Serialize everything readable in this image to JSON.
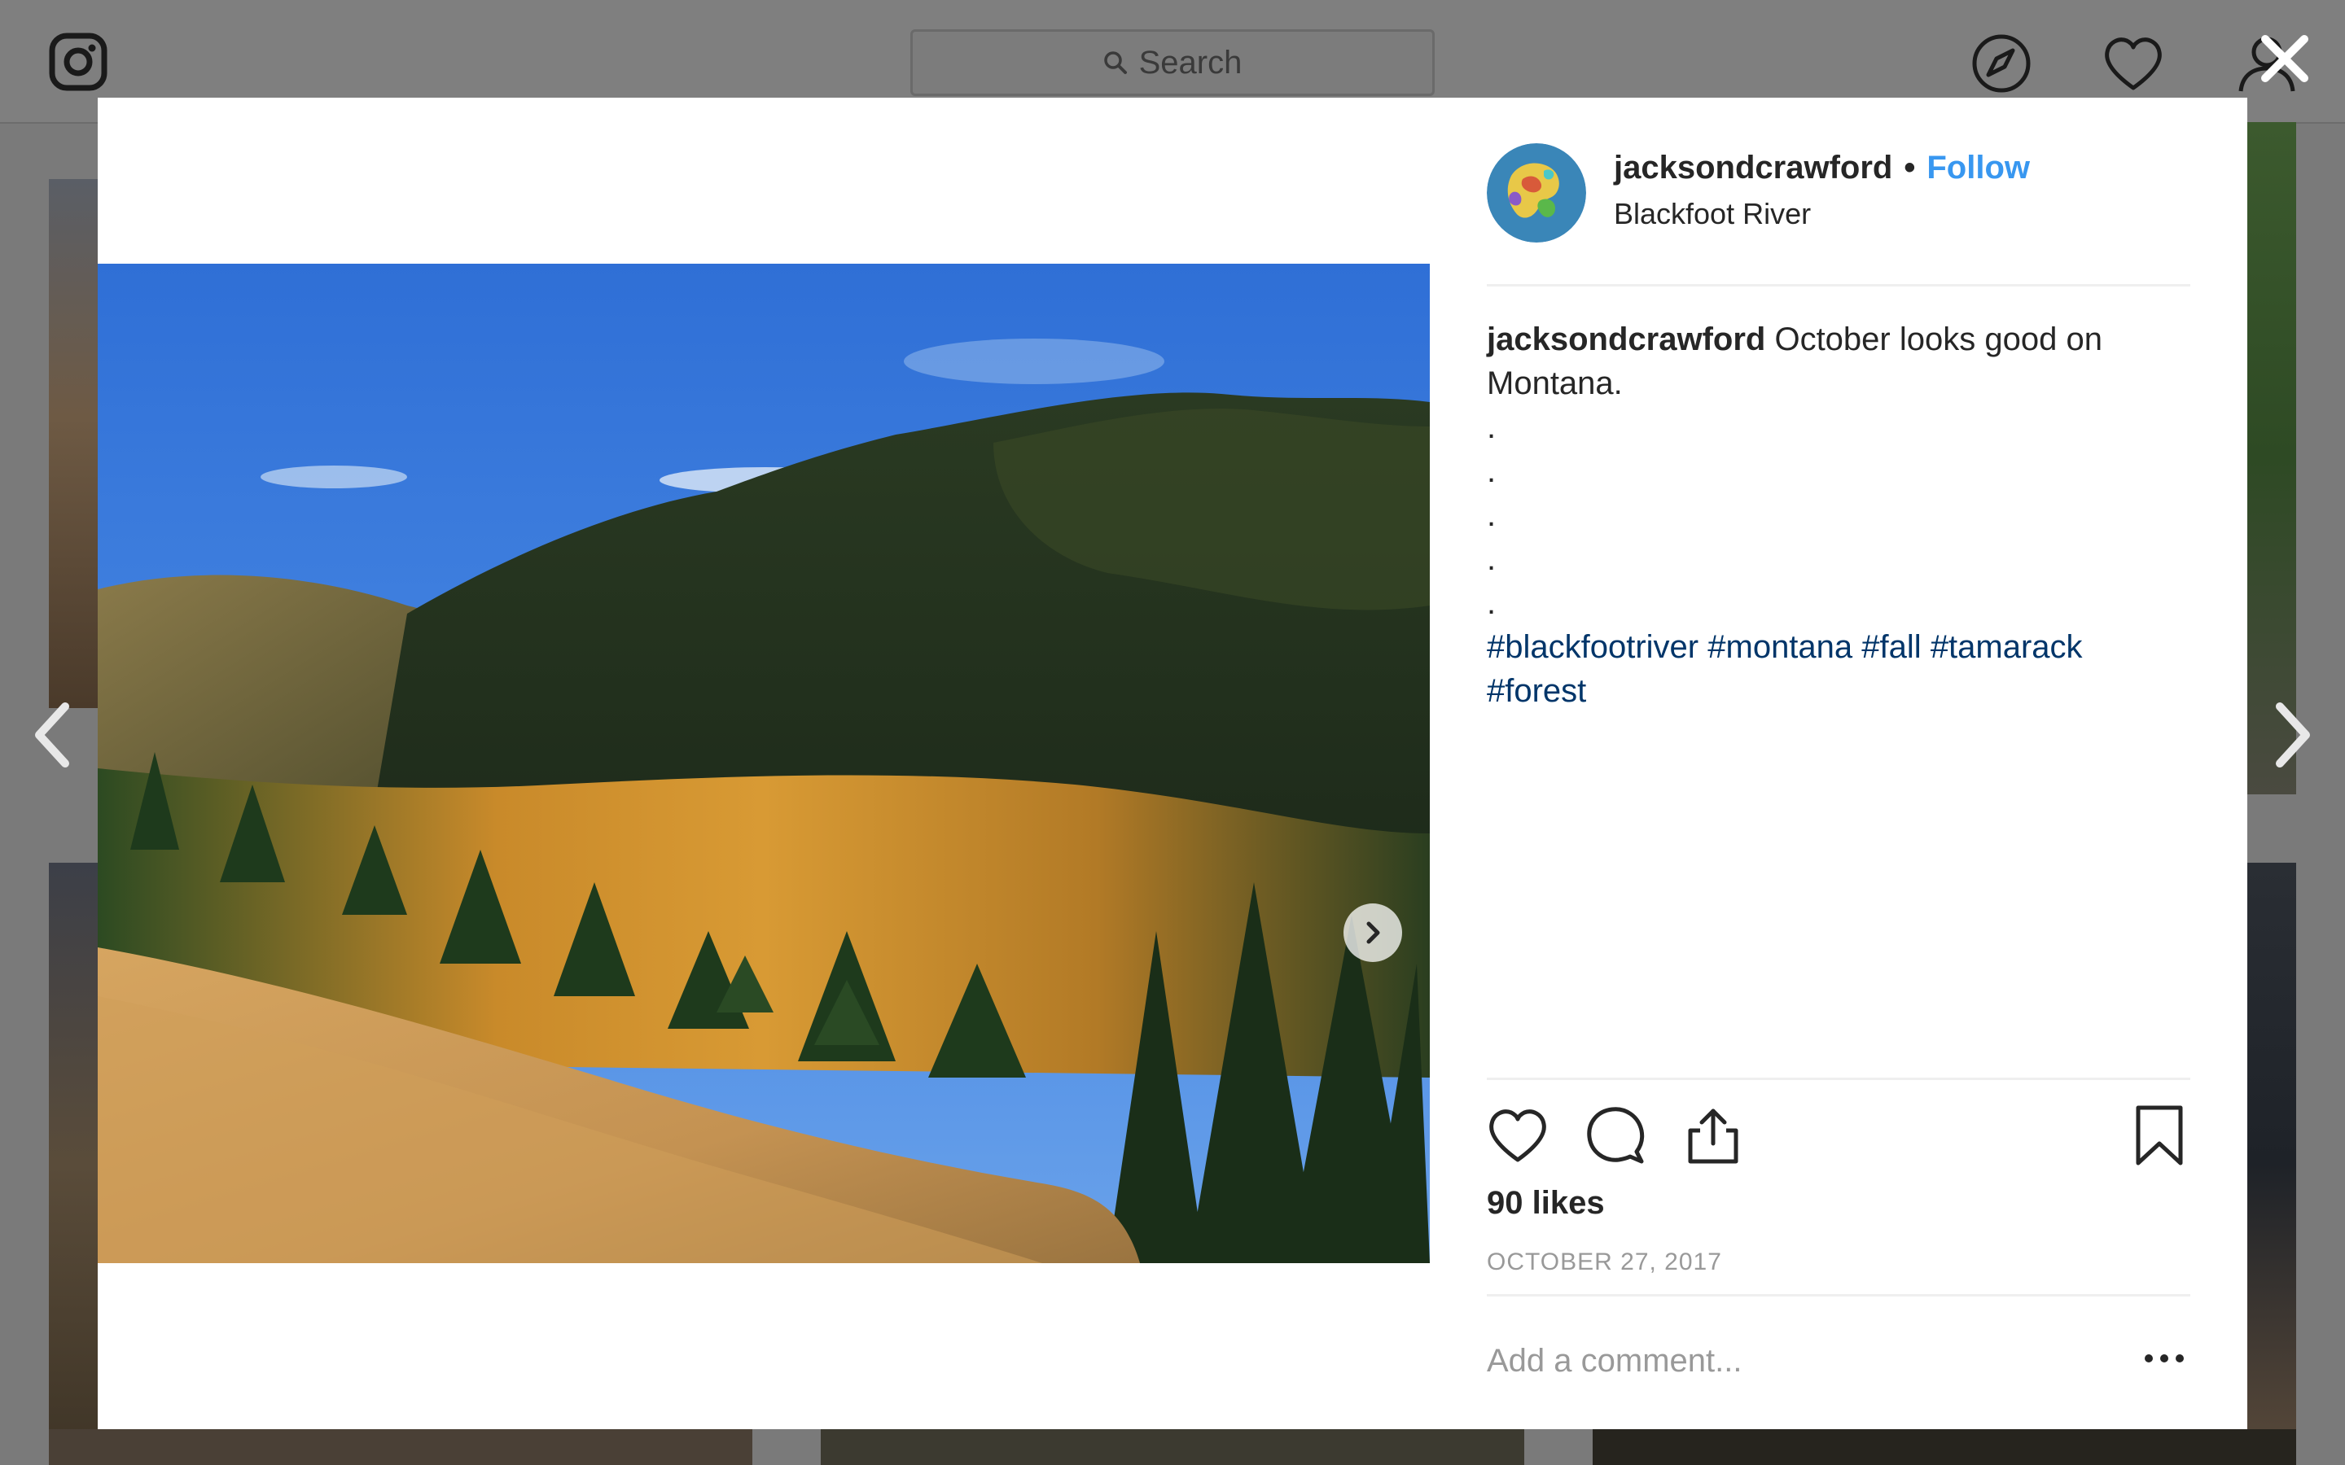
{
  "app": {
    "search_placeholder": "Search",
    "icons": [
      "instagram-logo-icon",
      "search-icon",
      "explore-compass-icon",
      "activity-heart-icon",
      "profile-icon",
      "close-icon",
      "chevron-left-icon",
      "chevron-right-icon"
    ]
  },
  "post": {
    "username": "jacksondcrawford",
    "separator": "•",
    "follow_label": "Follow",
    "location": "Blackfoot River",
    "caption": {
      "username": "jacksondcrawford",
      "text": "October looks good on Montana.",
      "dots": [
        ".",
        ".",
        ".",
        ".",
        "."
      ],
      "hashtags": [
        "#blackfootriver",
        "#montana",
        "#fall",
        "#tamarack",
        "#forest"
      ]
    },
    "likes": "90 likes",
    "date": "OCTOBER 27, 2017",
    "comment_placeholder": "Add a comment...",
    "photo_icon": "landscape-photo",
    "colors": {
      "follow": "#3897f0",
      "hashtag": "#003569",
      "muted": "#999999",
      "text": "#262626"
    }
  }
}
